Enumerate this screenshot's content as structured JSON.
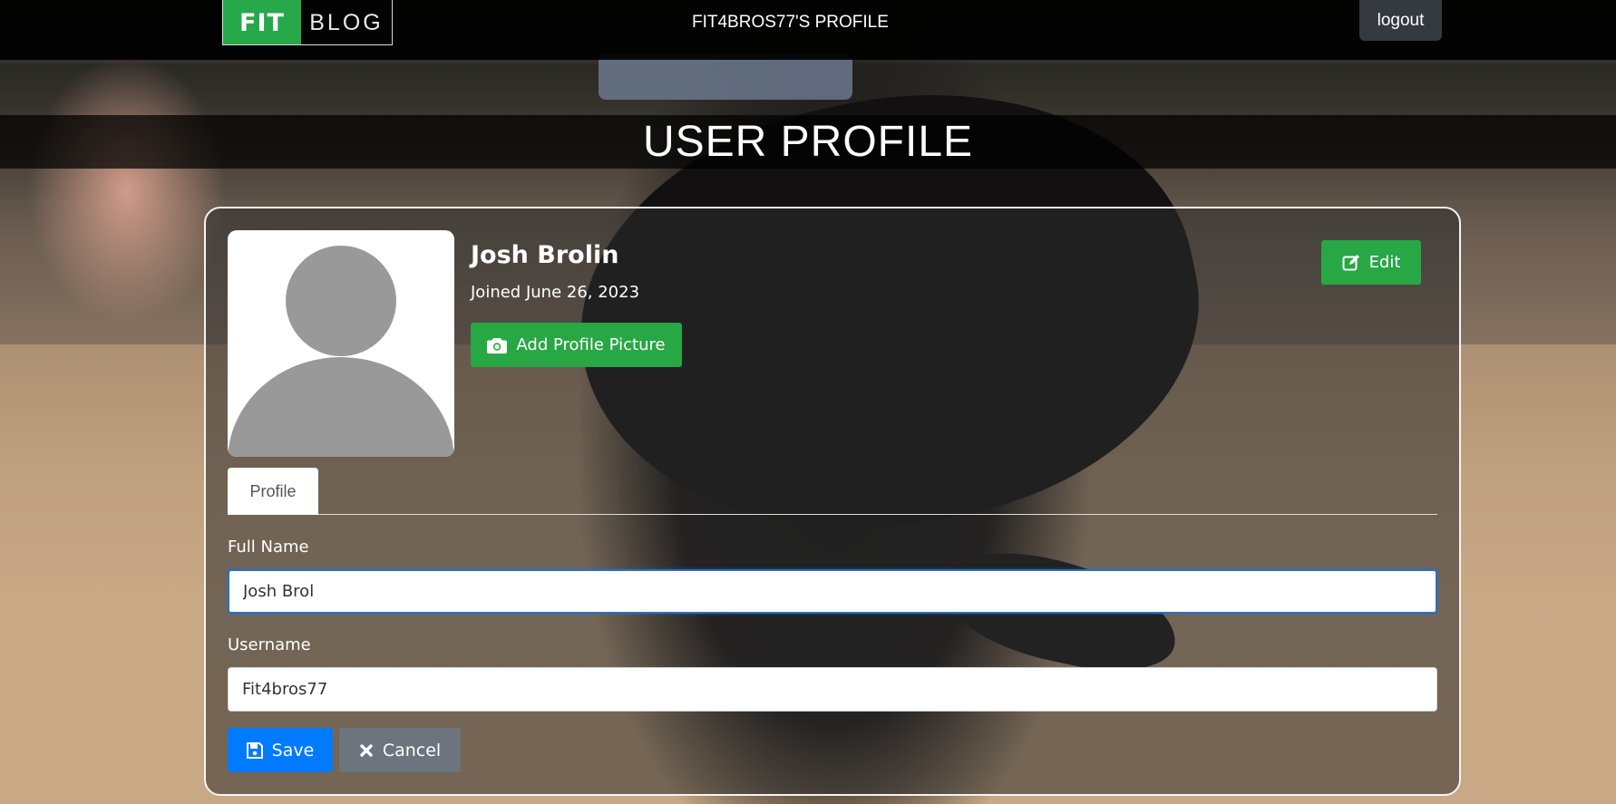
{
  "navbar": {
    "brand_fit": "FIT",
    "brand_blog": "BLOG",
    "title": "FIT4BROS77'S PROFILE",
    "logout_label": "logout"
  },
  "header": {
    "title": "USER PROFILE"
  },
  "profile": {
    "name": "Josh Brolin",
    "joined": "Joined June 26, 2023",
    "add_picture_label": "Add Profile Picture",
    "edit_label": "Edit"
  },
  "tabs": [
    {
      "label": "Profile",
      "active": true
    }
  ],
  "form": {
    "full_name_label": "Full Name",
    "full_name_value": "Josh Brol",
    "username_label": "Username",
    "username_value": "Fit4bros77",
    "save_label": "Save",
    "cancel_label": "Cancel"
  },
  "icons": {
    "camera": "camera-icon",
    "edit": "edit-icon",
    "save": "floppy-disk-icon",
    "cancel": "x-icon"
  },
  "colors": {
    "brand_green": "#28a745",
    "primary_blue": "#007bff",
    "secondary_gray": "#6c757d",
    "navbar_dark": "#000000"
  }
}
